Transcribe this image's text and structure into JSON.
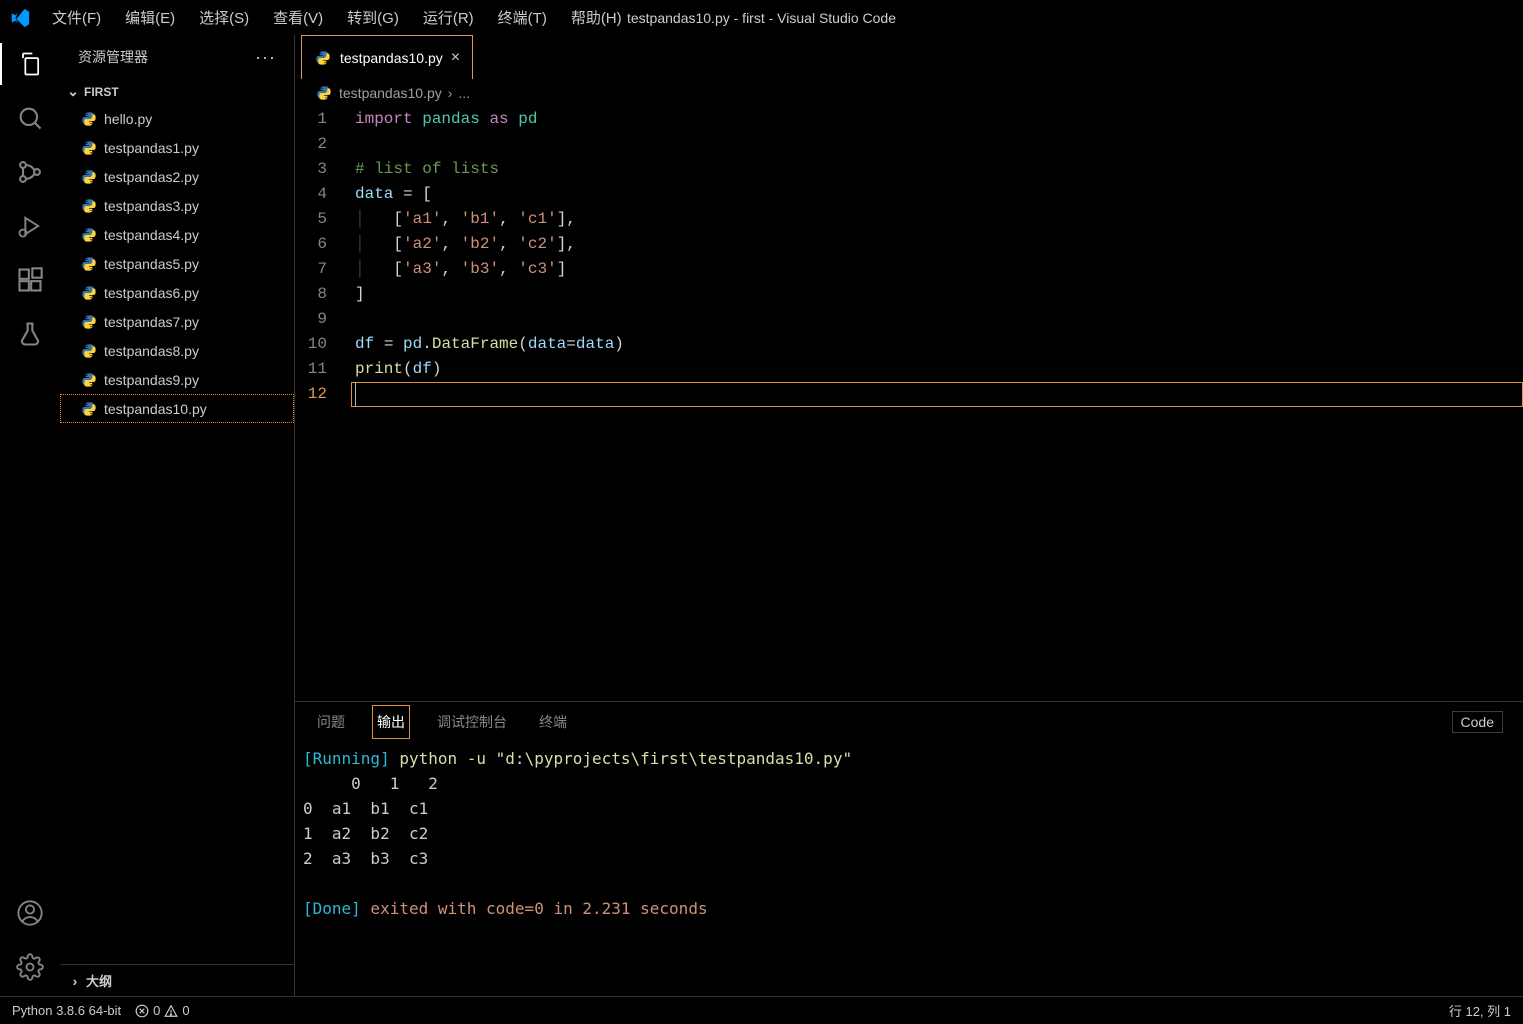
{
  "menu": {
    "file": "文件(F)",
    "edit": "编辑(E)",
    "select": "选择(S)",
    "view": "查看(V)",
    "go": "转到(G)",
    "run": "运行(R)",
    "terminal": "终端(T)",
    "help": "帮助(H)"
  },
  "window_title": "testpandas10.py - first - Visual Studio Code",
  "sidebar": {
    "title": "资源管理器",
    "actions_label": "···",
    "section_label": "FIRST",
    "files": [
      {
        "name": "hello.py"
      },
      {
        "name": "testpandas1.py"
      },
      {
        "name": "testpandas2.py"
      },
      {
        "name": "testpandas3.py"
      },
      {
        "name": "testpandas4.py"
      },
      {
        "name": "testpandas5.py"
      },
      {
        "name": "testpandas6.py"
      },
      {
        "name": "testpandas7.py"
      },
      {
        "name": "testpandas8.py"
      },
      {
        "name": "testpandas9.py"
      },
      {
        "name": "testpandas10.py"
      }
    ],
    "active_file_index": 10,
    "footer": "大纲"
  },
  "tabs": {
    "active": "testpandas10.py"
  },
  "breadcrumb": {
    "file": "testpandas10.py",
    "sep": "›",
    "more": "..."
  },
  "editor": {
    "line_count": 12,
    "current_line": 12
  },
  "panel": {
    "tabs": {
      "problems": "问题",
      "output": "输出",
      "debug": "调试控制台",
      "terminal": "终端"
    },
    "dropdown": "Code",
    "output": {
      "running_label": "[Running]",
      "running_cmd": " python -u \"d:\\pyprojects\\first\\testpandas10.py\"",
      "header_row": "     0   1   2",
      "rows": [
        "0  a1  b1  c1",
        "1  a2  b2  c2",
        "2  a3  b3  c3"
      ],
      "done_label": "[Done]",
      "done_msg": " exited with code=0 in 2.231 seconds"
    }
  },
  "status": {
    "python": "Python 3.8.6 64-bit",
    "errors": "0",
    "warnings": "0",
    "cursor": "行 12, 列 1"
  }
}
